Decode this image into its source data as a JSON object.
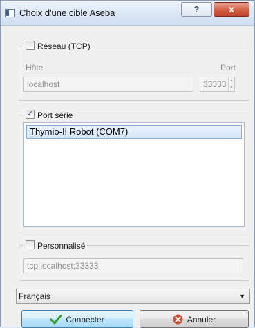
{
  "window": {
    "title": "Choix d'une cible Aseba",
    "help_label": "?",
    "close_label": "x"
  },
  "network": {
    "label": "Réseau (TCP)",
    "checked": false,
    "host_label": "Hôte",
    "port_label": "Port",
    "host_value": "localhost",
    "port_value": "33333"
  },
  "serial": {
    "label": "Port série",
    "checked": true,
    "check_mark": "✓",
    "ports": [
      "Thymio-II Robot (COM7)"
    ]
  },
  "custom": {
    "label": "Personnalisé",
    "checked": false,
    "value": "tcp:localhost;33333"
  },
  "language": {
    "selected": "Français"
  },
  "buttons": {
    "connect": "Connecter",
    "cancel": "Annuler"
  },
  "colors": {
    "close_button": "#c94a31",
    "selection": "#d5e6fa",
    "connect_check": "#2e9a2e",
    "cancel_icon": "#d4462d"
  },
  "icons": {
    "connect": "check-icon",
    "cancel": "cancel-icon",
    "combo": "chevron-down-icon"
  }
}
